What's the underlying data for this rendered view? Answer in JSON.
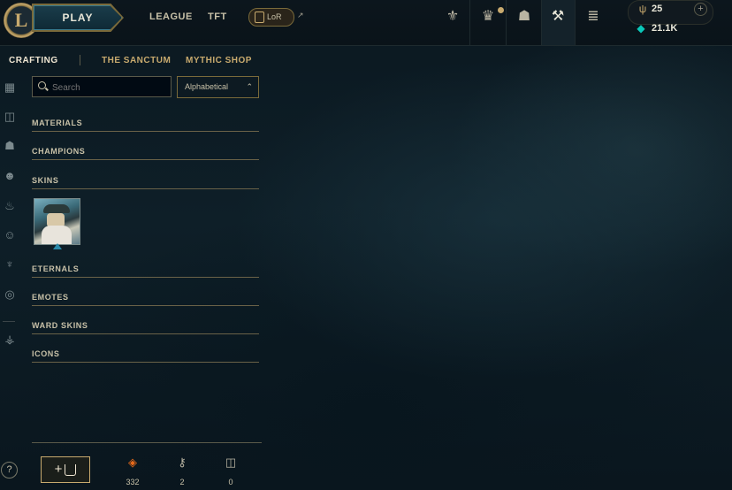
{
  "topbar": {
    "logo_letter": "L",
    "play_label": "PLAY",
    "nav": [
      "LEAGUE",
      "TFT"
    ],
    "lor_label": "LoR",
    "lor_ext": "↗",
    "icons": [
      "rank-icon",
      "missions-icon",
      "collection-icon",
      "crafting-icon",
      "store-icon"
    ],
    "rp_value": "25",
    "be_value": "21.1K",
    "plus_label": "+"
  },
  "subnav": {
    "items": [
      "CRAFTING",
      "THE SANCTUM",
      "MYTHIC SHOP"
    ],
    "active": "CRAFTING"
  },
  "rail": {
    "icons": [
      "all-icon",
      "chest-icon",
      "champion-icon",
      "skin-icon",
      "eternals-icon",
      "emote-icon",
      "ward-icon",
      "icon-icon",
      "misc-icon"
    ]
  },
  "filters": {
    "search_placeholder": "Search",
    "sort_value": "Alphabetical",
    "sort_chevron": "⌃⌄"
  },
  "categories": [
    "MATERIALS",
    "CHAMPIONS",
    "SKINS",
    "ETERNALS",
    "EMOTES",
    "WARD SKINS",
    "ICONS"
  ],
  "bottom": {
    "help_label": "?",
    "add_label": "+",
    "orange_essence": "332",
    "keys": "2",
    "chests": "0"
  },
  "colors": {
    "gold": "#c8aa6e",
    "blue_essence": "#0ac8b9",
    "orange": "#e86a1a"
  }
}
